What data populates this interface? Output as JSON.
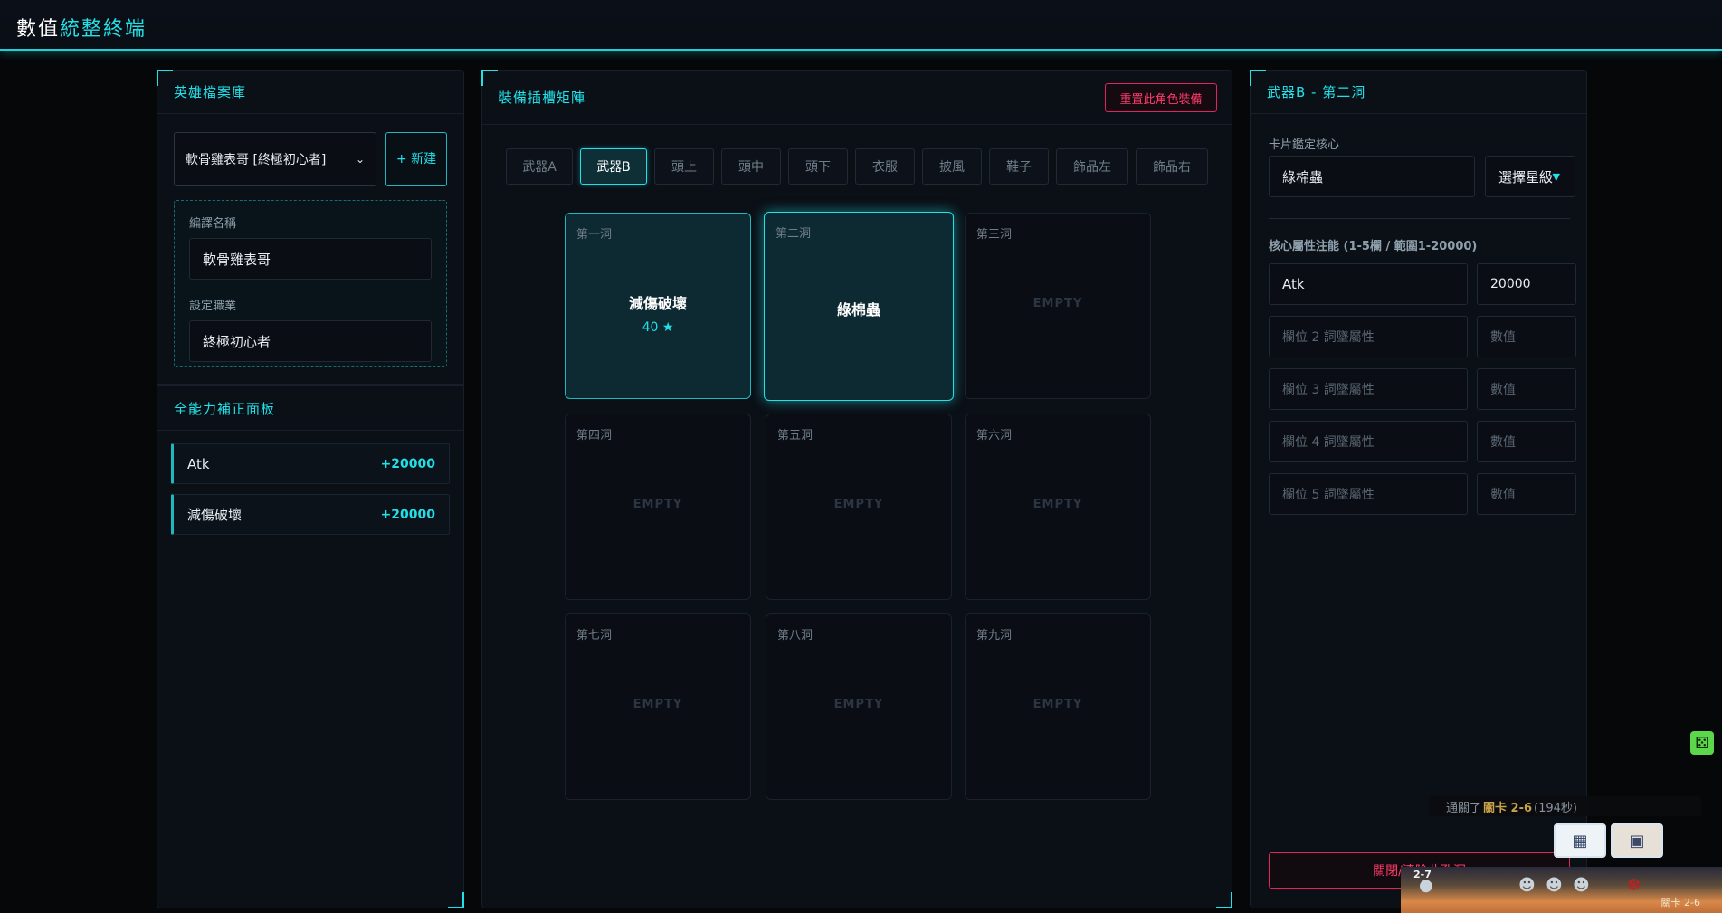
{
  "app": {
    "title_part1": "數值",
    "title_part2": "統",
    "title_part3": "整終端"
  },
  "left": {
    "header": "英雄檔案庫",
    "profile_select": "軟骨雞表哥 [終極初心者]",
    "new_button": "+ 新建",
    "name_label": "編譯名稱",
    "name_value": "軟骨雞表哥",
    "job_label": "設定職業",
    "job_value": "終極初心者",
    "stats_header": "全能力補正面板",
    "stats": [
      {
        "name": "Atk",
        "value": "+20000"
      },
      {
        "name": "減傷破壞",
        "value": "+20000"
      }
    ]
  },
  "middle": {
    "header": "裝備插槽矩陣",
    "reset_button": "重置此角色裝備",
    "tabs": [
      "武器A",
      "武器B",
      "頭上",
      "頭中",
      "頭下",
      "衣服",
      "披風",
      "鞋子",
      "飾品左",
      "飾品右"
    ],
    "active_tab": "武器B",
    "empty_text": "EMPTY",
    "slots": [
      {
        "label": "第一洞",
        "card": "減傷破壞",
        "stars": "40 ★"
      },
      {
        "label": "第二洞",
        "card": "綠棉蟲",
        "stars": ""
      },
      {
        "label": "第三洞",
        "card": "",
        "stars": ""
      },
      {
        "label": "第四洞",
        "card": "",
        "stars": ""
      },
      {
        "label": "第五洞",
        "card": "",
        "stars": ""
      },
      {
        "label": "第六洞",
        "card": "",
        "stars": ""
      },
      {
        "label": "第七洞",
        "card": "",
        "stars": ""
      },
      {
        "label": "第八洞",
        "card": "",
        "stars": ""
      },
      {
        "label": "第九洞",
        "card": "",
        "stars": ""
      }
    ]
  },
  "right": {
    "header": "武器B - 第二洞",
    "core_label": "卡片鑑定核心",
    "core_value": "綠棉蟲",
    "star_select": "選擇星級",
    "attr_label": "核心屬性注能 (1-5欄 / 範圍1-20000)",
    "attrs": [
      {
        "name": "Atk",
        "value": "20000"
      },
      {
        "name": "欄位 2 詞墜屬性",
        "value": "數值"
      },
      {
        "name": "欄位 3 詞墜屬性",
        "value": "數值"
      },
      {
        "name": "欄位 4 詞墜屬性",
        "value": "數值"
      },
      {
        "name": "欄位 5 詞墜屬性",
        "value": "數值"
      }
    ],
    "unlock_button": "關閉/清除此孔洞"
  },
  "game_overlay": {
    "toast_prefix": "通關了",
    "toast_stage": "關卡 2-6",
    "toast_time": "(194秒)",
    "strip_label": "2-7",
    "stage_label": "關卡 2-6"
  }
}
